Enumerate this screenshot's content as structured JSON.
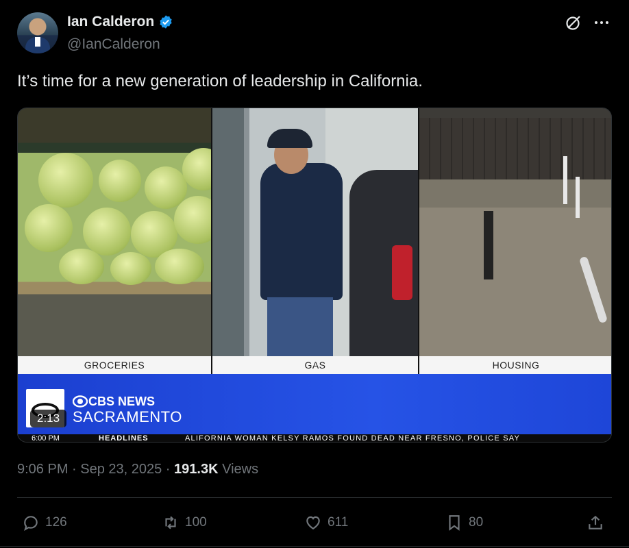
{
  "author": {
    "name": "Ian Calderon",
    "handle": "@IanCalderon"
  },
  "tweet": {
    "text": "It’s time for a new generation of leadership in California."
  },
  "media": {
    "labels": [
      "GROCERIES",
      "GAS",
      "HOUSING"
    ],
    "network": "CBS NEWS",
    "station": "SACRAMENTO",
    "duration": "2:13",
    "ticker": {
      "time": "6:00 PM",
      "section": "HEADLINES",
      "text": "ALIFORNIA WOMAN KELSY RAMOS FOUND DEAD NEAR FRESNO, POLICE SAY"
    }
  },
  "meta": {
    "timestamp": "9:06 PM · Sep 23, 2025 · ",
    "views_count": "191.3K",
    "views_label": " Views"
  },
  "actions": {
    "replies": "126",
    "reposts": "100",
    "likes": "611",
    "bookmarks": "80"
  },
  "colors": {
    "background": "#000000",
    "text": "#e7e9ea",
    "secondary": "#71767b",
    "verified": "#1d9bf0",
    "banner": "#2653e6"
  }
}
